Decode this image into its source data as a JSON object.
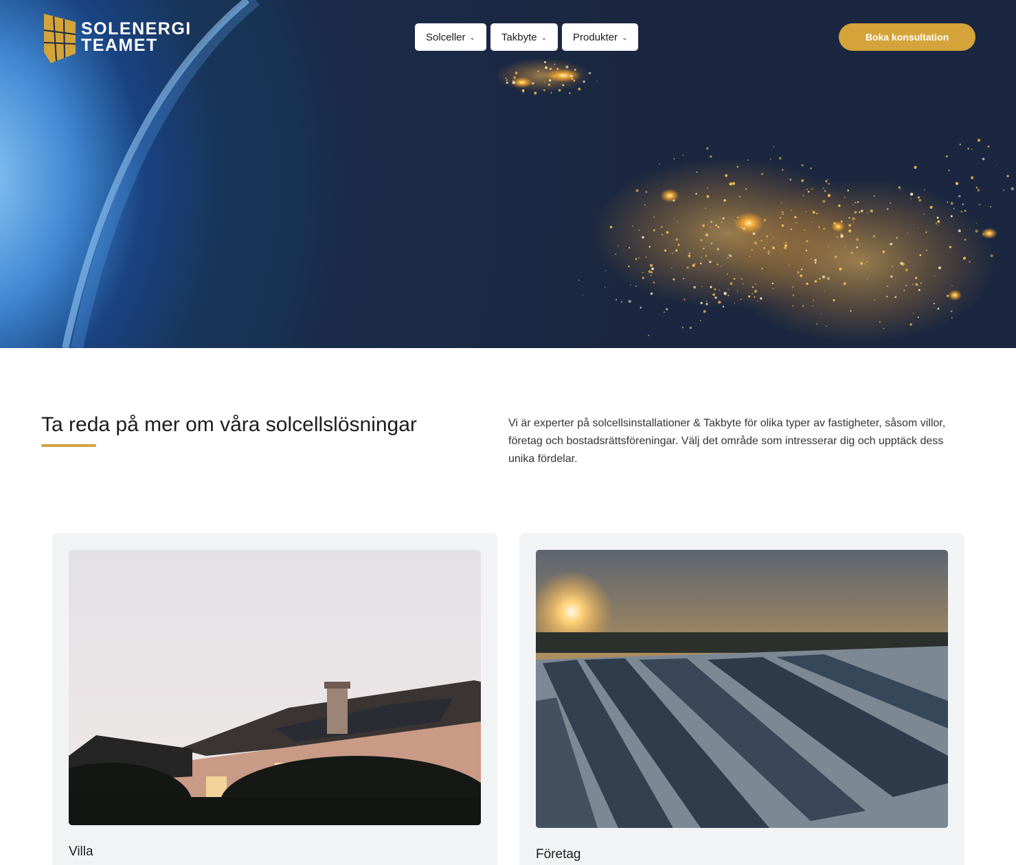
{
  "header": {
    "logo": {
      "line1": "SOLENERGI",
      "line2": "TEAMET",
      "icon": "solar-panel-logo-icon"
    },
    "nav": [
      {
        "label": "Solceller",
        "icon": "chevron-down-icon"
      },
      {
        "label": "Takbyte",
        "icon": "chevron-down-icon"
      },
      {
        "label": "Produkter",
        "icon": "chevron-down-icon"
      }
    ],
    "cta_label": "Boka konsultation"
  },
  "hero": {
    "image": "earth-from-space-night-lights"
  },
  "intro": {
    "title": "Ta reda på mer om våra solcellslösningar",
    "text": "Vi är experter på solcellsinstallationer & Takbyte för olika typer av fastigheter, såsom villor, företag och bostadsrättsföreningar. Välj det område som intresserar dig och upptäck dess unika fördelar."
  },
  "cards": [
    {
      "label": "Villa",
      "image": "house-with-solar-roof-at-dusk"
    },
    {
      "label": "Företag",
      "image": "commercial-roof-solar-panels-sunset"
    }
  ],
  "colors": {
    "accent": "#d4a43a",
    "card_bg": "#f2f3f5",
    "text": "#1c1c1c"
  }
}
